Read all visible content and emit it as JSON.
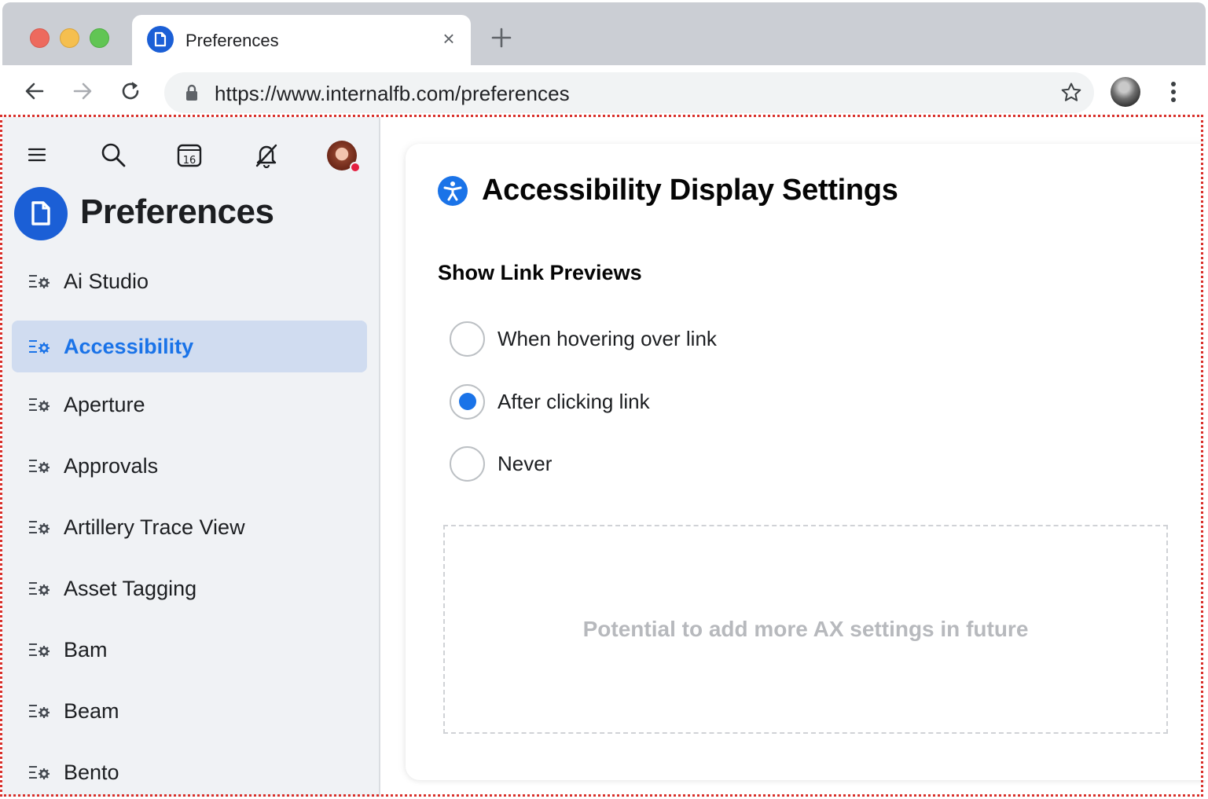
{
  "browser": {
    "tab_title": "Preferences",
    "url": "https://www.internalfb.com/preferences",
    "icons": {
      "back": "arrow-left-icon",
      "forward": "arrow-right-icon",
      "reload": "reload-icon",
      "lock": "lock-icon",
      "bookmark": "star-icon",
      "menu": "kebab-icon",
      "close_tab": "close-icon",
      "new_tab": "plus-icon"
    }
  },
  "sidebar": {
    "app_title": "Preferences",
    "items": [
      {
        "label": "Ai Studio",
        "active": false
      },
      {
        "label": "Accessibility",
        "active": true
      },
      {
        "label": "Aperture",
        "active": false
      },
      {
        "label": "Approvals",
        "active": false
      },
      {
        "label": "Artillery Trace View",
        "active": false
      },
      {
        "label": "Asset Tagging",
        "active": false
      },
      {
        "label": "Bam",
        "active": false
      },
      {
        "label": "Beam",
        "active": false
      },
      {
        "label": "Bento",
        "active": false
      }
    ],
    "calendar_day": "16"
  },
  "main": {
    "title": "Accessibility Display Settings",
    "section_title": "Show Link Previews",
    "options": [
      {
        "label": "When hovering over link",
        "checked": false
      },
      {
        "label": "After clicking link",
        "checked": true
      },
      {
        "label": "Never",
        "checked": false
      }
    ],
    "placeholder": "Potential to add more AX settings in future"
  },
  "colors": {
    "accent": "#1a73e8",
    "brand": "#1b5fd6",
    "sidebar_bg": "#f0f2f5",
    "active_item_bg": "#d0dcf0",
    "annotation_border": "#d9312c"
  }
}
